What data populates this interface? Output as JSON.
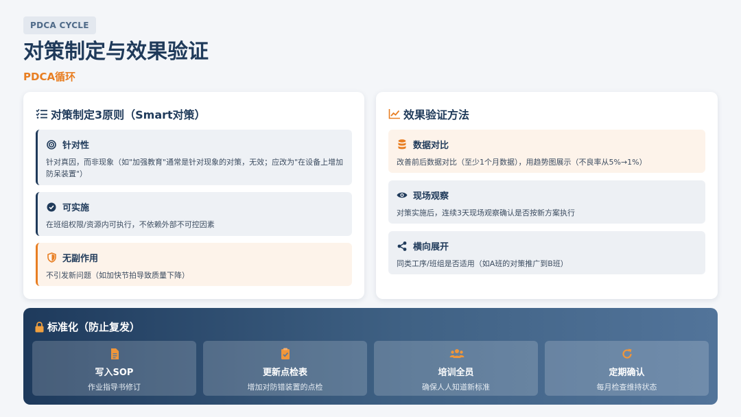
{
  "header": {
    "tag": "PDCA CYCLE",
    "title": "对策制定与效果验证",
    "subtitle": "PDCA循环"
  },
  "left_card": {
    "title": "对策制定3原则（Smart对策）",
    "items": [
      {
        "icon": "target-icon",
        "title": "针对性",
        "desc": "针对真因，而非现象（如\"加强教育\"通常是针对现象的对策，无效；应改为\"在设备上增加防呆装置\"）"
      },
      {
        "icon": "check-circle-icon",
        "title": "可实施",
        "desc": "在班组权限/资源内可执行，不依赖外部不可控因素"
      },
      {
        "icon": "shield-icon",
        "title": "无副作用",
        "desc": "不引发新问题（如加快节拍导致质量下降）"
      }
    ]
  },
  "right_card": {
    "title": "效果验证方法",
    "items": [
      {
        "icon": "database-icon",
        "title": "数据对比",
        "desc": "改善前后数据对比（至少1个月数据），用趋势图展示（不良率从5%→1%）"
      },
      {
        "icon": "eye-icon",
        "title": "现场观察",
        "desc": "对策实施后，连续3天现场观察确认是否按新方案执行"
      },
      {
        "icon": "share-icon",
        "title": "横向展开",
        "desc": "同类工序/班组是否适用（如A班的对策推广到B班）"
      }
    ]
  },
  "standardize": {
    "title": "标准化（防止复发）",
    "steps": [
      {
        "icon": "document-icon",
        "label": "写入SOP",
        "desc": "作业指导书修订"
      },
      {
        "icon": "clipboard-check-icon",
        "label": "更新点检表",
        "desc": "增加对防错装置的点检"
      },
      {
        "icon": "people-icon",
        "label": "培训全员",
        "desc": "确保人人知道新标准"
      },
      {
        "icon": "refresh-icon",
        "label": "定期确认",
        "desc": "每月检查维持状态"
      }
    ]
  },
  "colors": {
    "navy": "#1f3a5a",
    "accent_orange": "#e87e22",
    "orange_tint": "#fdf3ea",
    "gray_tint": "#eef1f5"
  }
}
